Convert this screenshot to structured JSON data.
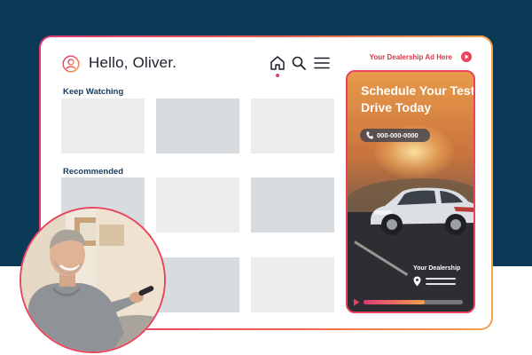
{
  "header": {
    "greeting": "Hello, Oliver."
  },
  "sections": [
    {
      "title": "Keep Watching"
    },
    {
      "title": "Recommended"
    }
  ],
  "ad": {
    "label": "Your Dealership Ad Here",
    "headline": "Schedule Your Test Drive Today",
    "phone": "000-000-0000",
    "dealer_name": "Your Dealership",
    "progress": 0.62
  },
  "icons": {
    "avatar": "user-circle-icon",
    "home": "home-icon",
    "search": "search-icon",
    "menu": "hamburger-menu-icon",
    "ad_play": "play-icon",
    "phone": "phone-icon",
    "location": "map-pin-icon"
  },
  "colors": {
    "background": "#0a3a55",
    "accent_start": "#e13a78",
    "accent_end": "#f5a04a",
    "section_title": "#163a5c",
    "ad_label": "#d9374a"
  }
}
